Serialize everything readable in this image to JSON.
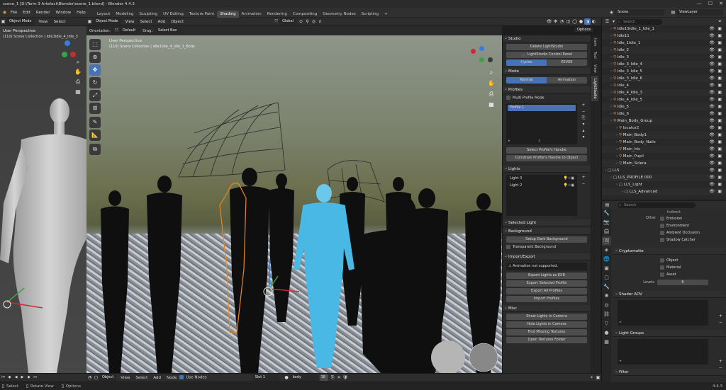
{
  "titlebar": {
    "title": "scene_1 [D:\\Term 3 Artefact\\Blender\\scene_1.blend] - Blender 4.4.3",
    "minimize": "—",
    "maximize": "☐",
    "close": "✕"
  },
  "menu": {
    "items": [
      "File",
      "Edit",
      "Render",
      "Window",
      "Help"
    ]
  },
  "workspaces": {
    "tabs": [
      "Layout",
      "Modeling",
      "Sculpting",
      "UV Editing",
      "Texture Paint",
      "Shading",
      "Animation",
      "Rendering",
      "Compositing",
      "Geometry Nodes",
      "Scripting"
    ],
    "active": "Shading",
    "add": "+"
  },
  "scene": {
    "label": "Scene",
    "view_layer": "ViewLayer"
  },
  "left_view": {
    "mode": "Object Mode",
    "menus": [
      "View",
      "Select"
    ],
    "title": "User Perspective",
    "subtitle": "(110) Scene Collection | Idle1Idle_4_Idle_3"
  },
  "viewport": {
    "header": {
      "orientation_label": "Orientation:",
      "orientation": "Default",
      "drag_label": "Drag:",
      "drag": "Select Box",
      "mode": "Object Mode",
      "menus": [
        "View",
        "Select",
        "Add",
        "Object"
      ],
      "transform": "Global",
      "options": "Options"
    },
    "overlay_title": "User Perspective",
    "overlay_subtitle": "(110) Scene Collection | Idle1Idle_4_Idle_3_Body"
  },
  "sidebar_tabs": [
    "Item",
    "Tool",
    "View",
    "LightStudio"
  ],
  "npanel": {
    "studio": {
      "title": "Studio",
      "delete": "Delete LightStudio",
      "control_panel": "LightStudio Control Panel",
      "engines": [
        "Cycles",
        "EEVEE"
      ],
      "active_engine": "Cycles"
    },
    "mode": {
      "title": "Mode",
      "options": [
        "Normal",
        "Animation"
      ],
      "active": "Normal"
    },
    "profiles": {
      "title": "Profiles",
      "multi": "Multi Profile Mode",
      "items": [
        "Profile 1"
      ],
      "select_handle": "Select Profile's Handle",
      "constrain": "Constrain Profile's Handle to Object"
    },
    "lights": {
      "title": "Lights",
      "items": [
        "Light 0",
        "Light 2"
      ]
    },
    "selected_light": {
      "title": "Selected Light"
    },
    "background": {
      "title": "Background",
      "setup": "Setup Dark Background",
      "transparent": "Transparent Background"
    },
    "import_export": {
      "title": "Import/Export",
      "warning": "Animation not supported.",
      "buttons": [
        "Export Lights as EXR",
        "Export Selected Profile",
        "Export All Profiles",
        "Import Profiles"
      ]
    },
    "misc": {
      "title": "Misc",
      "buttons": [
        "Show Lights in Camera",
        "Hide Lights in Camera",
        "Find Missing Textures",
        "Open Textures Folder"
      ]
    }
  },
  "outliner": {
    "search_placeholder": "Search",
    "rows": [
      {
        "name": "Idle1SIdle_1_Idle_1",
        "indent": 1
      },
      {
        "name": "Idle11",
        "indent": 1
      },
      {
        "name": "Idle_1Idle_1",
        "indent": 1
      },
      {
        "name": "Idle_2",
        "indent": 1
      },
      {
        "name": "Idle_3",
        "indent": 1
      },
      {
        "name": "Idle_3_Idle_4",
        "indent": 1
      },
      {
        "name": "Idle_3_Idle_5",
        "indent": 1
      },
      {
        "name": "Idle_3_Idle_6",
        "indent": 1
      },
      {
        "name": "Idle_4",
        "indent": 1
      },
      {
        "name": "Idle_4_Idle_3",
        "indent": 1
      },
      {
        "name": "Idle_4_Idle_5",
        "indent": 1
      },
      {
        "name": "Idle_5",
        "indent": 1
      },
      {
        "name": "Idle_6",
        "indent": 1
      },
      {
        "name": "Main_Body_Group",
        "indent": 1
      },
      {
        "name": "locator2",
        "indent": 2
      },
      {
        "name": "Main_Body1",
        "indent": 2
      },
      {
        "name": "Main_Body_Nails",
        "indent": 2
      },
      {
        "name": "Main_Iris",
        "indent": 2
      },
      {
        "name": "Main_Pupil",
        "indent": 2
      },
      {
        "name": "Main_Sclera",
        "indent": 2
      },
      {
        "name": "LLS",
        "indent": 0
      },
      {
        "name": "LLS_PROFILE.000",
        "indent": 1
      },
      {
        "name": "LLS_Light",
        "indent": 2
      },
      {
        "name": "LLS_Advanced",
        "indent": 3
      }
    ]
  },
  "properties": {
    "search_placeholder": "Search",
    "indirect": "Indirect",
    "other_label": "Other",
    "other": [
      "Emission",
      "Environment",
      "Ambient Occlusion",
      "Shadow Catcher"
    ],
    "cryptomatte": {
      "title": "Cryptomatte",
      "items": [
        "Object",
        "Material",
        "Asset"
      ],
      "levels_label": "Levels",
      "levels": "6"
    },
    "shader_aov": "Shader AOV",
    "light_groups": "Light Groups",
    "filter": "Filter"
  },
  "shader_editor": {
    "editor": "Object",
    "menus": [
      "View",
      "Select",
      "Add",
      "Node"
    ],
    "use_nodes": "Use Nodes",
    "slot": "Slot 1",
    "material": "body",
    "users": "16"
  },
  "status": {
    "select": "Select",
    "rotate": "Rotate View",
    "options": "Options",
    "version": "4.4.3"
  }
}
